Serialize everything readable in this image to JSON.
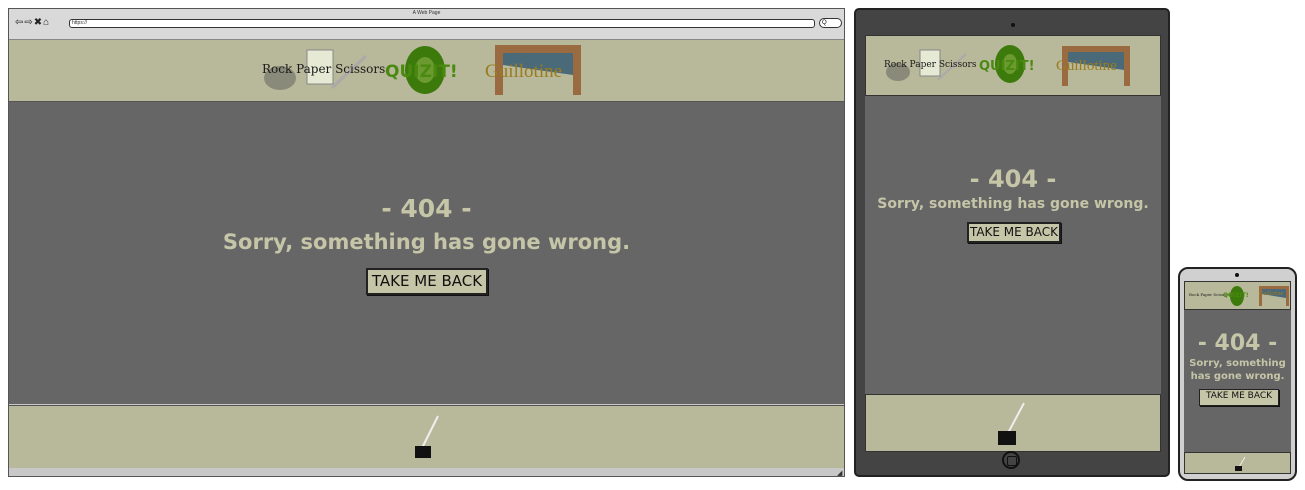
{
  "browser": {
    "window_title": "A Web Page",
    "url": "https://",
    "search_placeholder": "Q",
    "nav_icons": [
      "back-icon",
      "forward-icon",
      "close-icon",
      "home-icon"
    ]
  },
  "header": {
    "logos": [
      {
        "name": "rock-paper-scissors",
        "text": "Rock Paper Scissors"
      },
      {
        "name": "quiz-it",
        "text": "QUIZIT!"
      },
      {
        "name": "guillotine",
        "text": "Guillotine"
      }
    ]
  },
  "error": {
    "code": "- 404 -",
    "message": "Sorry, something has gone wrong.",
    "button": "TAKE ME BACK"
  },
  "footer": {
    "icon": "quill-ink-icon"
  },
  "colors": {
    "header_bg": "#b8b89a",
    "main_bg": "#666666",
    "text_accent": "#c5c5a8"
  }
}
